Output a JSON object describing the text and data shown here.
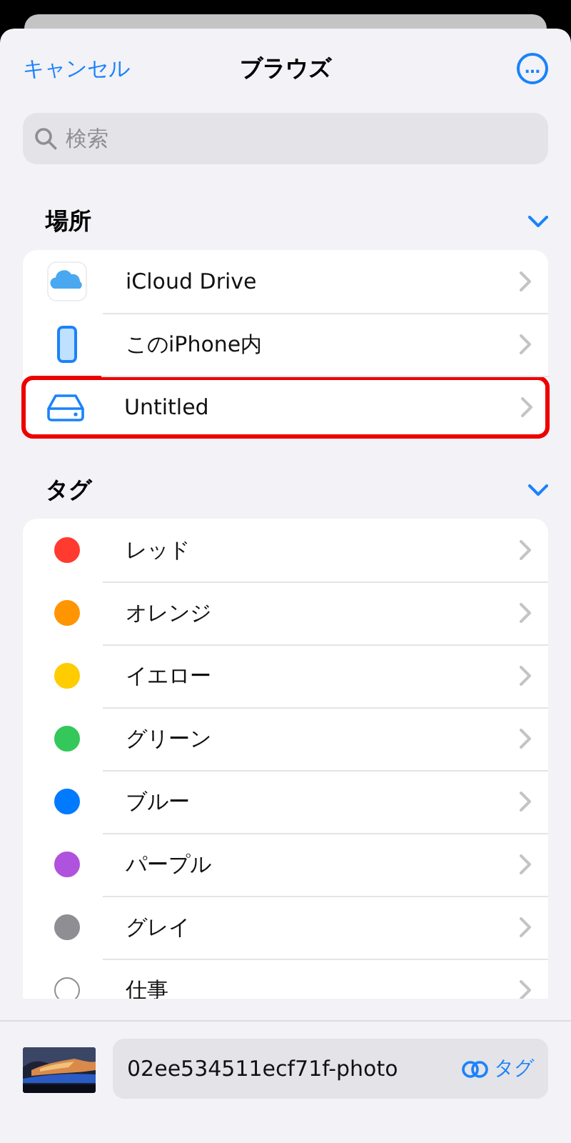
{
  "nav": {
    "cancel": "キャンセル",
    "title": "ブラウズ",
    "more": "…"
  },
  "search": {
    "placeholder": "検索"
  },
  "locations": {
    "title": "場所",
    "expanded": true,
    "items": [
      {
        "label": "iCloud Drive",
        "kind": "cloud",
        "highlighted": false
      },
      {
        "label": "このiPhone内",
        "kind": "phone",
        "highlighted": false
      },
      {
        "label": "Untitled",
        "kind": "drive",
        "highlighted": true
      }
    ]
  },
  "tags": {
    "title": "タグ",
    "expanded": true,
    "items": [
      {
        "label": "レッド",
        "kind": "dot",
        "color": "#ff3b30"
      },
      {
        "label": "オレンジ",
        "kind": "dot",
        "color": "#ff9500"
      },
      {
        "label": "イエロー",
        "kind": "dot",
        "color": "#ffcc00"
      },
      {
        "label": "グリーン",
        "kind": "dot",
        "color": "#34c759"
      },
      {
        "label": "ブルー",
        "kind": "dot",
        "color": "#007aff"
      },
      {
        "label": "パープル",
        "kind": "dot",
        "color": "#af52de"
      },
      {
        "label": "グレイ",
        "kind": "dot",
        "color": "#8e8e93"
      },
      {
        "label": "仕事",
        "kind": "outline"
      }
    ]
  },
  "bottom_bar": {
    "filename": "02ee534511ecf71f-photo",
    "tag_button": "タグ"
  }
}
